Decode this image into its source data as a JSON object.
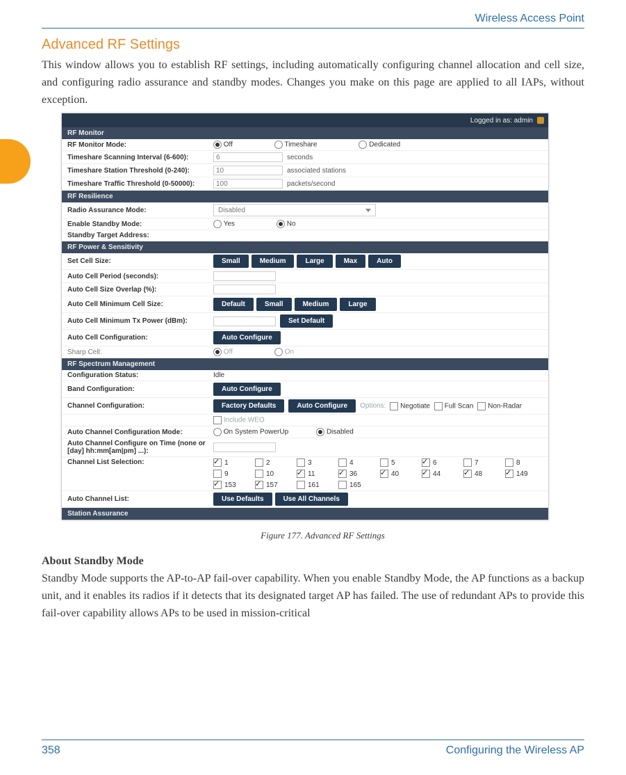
{
  "header": {
    "running": "Wireless Access Point"
  },
  "title": "Advanced RF Settings",
  "intro": "This window allows you to establish RF settings, including automatically configuring channel allocation and cell size, and configuring radio assurance and standby modes. Changes you make on this page are applied to all IAPs, without exception.",
  "caption": "Figure 177. Advanced RF Settings",
  "subhead": "About Standby Mode",
  "body2": "Standby Mode supports the AP-to-AP fail-over capability. When you enable Standby Mode, the AP functions as a backup unit, and it enables its radios if it detects that its designated target AP has failed. The use of redundant APs to provide this fail-over capability allows APs to be used in mission-critical",
  "footer": {
    "page": "358",
    "section": "Configuring the Wireless AP"
  },
  "shot": {
    "login": "Logged in as: admin",
    "sec_monitor": "RF Monitor",
    "monitor_mode_lbl": "RF Monitor Mode:",
    "monitor_opts": {
      "off": "Off",
      "timeshare": "Timeshare",
      "dedicated": "Dedicated"
    },
    "ts_interval_lbl": "Timeshare Scanning Interval (6-600):",
    "ts_interval_val": "6",
    "ts_interval_unit": "seconds",
    "ts_station_lbl": "Timeshare Station Threshold (0-240):",
    "ts_station_val": "10",
    "ts_station_unit": "associated stations",
    "ts_traffic_lbl": "Timeshare Traffic Threshold (0-50000):",
    "ts_traffic_val": "100",
    "ts_traffic_unit": "packets/second",
    "sec_resilience": "RF Resilience",
    "radio_assurance_lbl": "Radio Assurance Mode:",
    "radio_assurance_val": "Disabled",
    "enable_standby_lbl": "Enable Standby Mode:",
    "yes": "Yes",
    "no": "No",
    "standby_target_lbl": "Standby Target Address:",
    "sec_power": "RF Power & Sensitivity",
    "set_cell_lbl": "Set Cell Size:",
    "cell_sizes": [
      "Small",
      "Medium",
      "Large",
      "Max",
      "Auto"
    ],
    "auto_period_lbl": "Auto Cell Period (seconds):",
    "auto_overlap_lbl": "Auto Cell Size Overlap (%):",
    "auto_min_cell_lbl": "Auto Cell Minimum Cell Size:",
    "min_cell_sizes": [
      "Default",
      "Small",
      "Medium",
      "Large"
    ],
    "auto_min_tx_lbl": "Auto Cell Minimum Tx Power (dBm):",
    "set_default": "Set Default",
    "auto_cell_cfg_lbl": "Auto Cell Configuration:",
    "auto_configure": "Auto Configure",
    "sharp_cell_lbl": "Sharp Cell:",
    "sharp_off": "Off",
    "sharp_on": "On",
    "sec_spectrum": "RF Spectrum Management",
    "cfg_status_lbl": "Configuration Status:",
    "cfg_status_val": "Idle",
    "band_cfg_lbl": "Band Configuration:",
    "chan_cfg_lbl": "Channel Configuration:",
    "factory_defaults": "Factory Defaults",
    "options_lbl": "Options:",
    "opt_negotiate": "Negotiate",
    "opt_fullscan": "Full Scan",
    "opt_nonradar": "Non-Radar",
    "include_weo": "Include WEO",
    "auto_chan_mode_lbl": "Auto Channel Configuration Mode:",
    "on_powerup": "On System PowerUp",
    "disabled": "Disabled",
    "auto_chan_time_lbl": "Auto Channel Configure on Time (none or [day] hh:mm[am|pm] ...):",
    "chan_list_sel_lbl": "Channel List Selection:",
    "channels": [
      "1",
      "2",
      "3",
      "4",
      "5",
      "6",
      "7",
      "8",
      "9",
      "10",
      "11",
      "36",
      "40",
      "44",
      "48",
      "149",
      "153",
      "157",
      "161",
      "165"
    ],
    "channels_selected": [
      true,
      false,
      false,
      false,
      false,
      true,
      false,
      false,
      false,
      false,
      true,
      true,
      true,
      true,
      true,
      true,
      true,
      true,
      false,
      false
    ],
    "auto_chan_list_lbl": "Auto Channel List:",
    "use_defaults": "Use Defaults",
    "use_all": "Use All Channels",
    "sec_station": "Station Assurance"
  }
}
